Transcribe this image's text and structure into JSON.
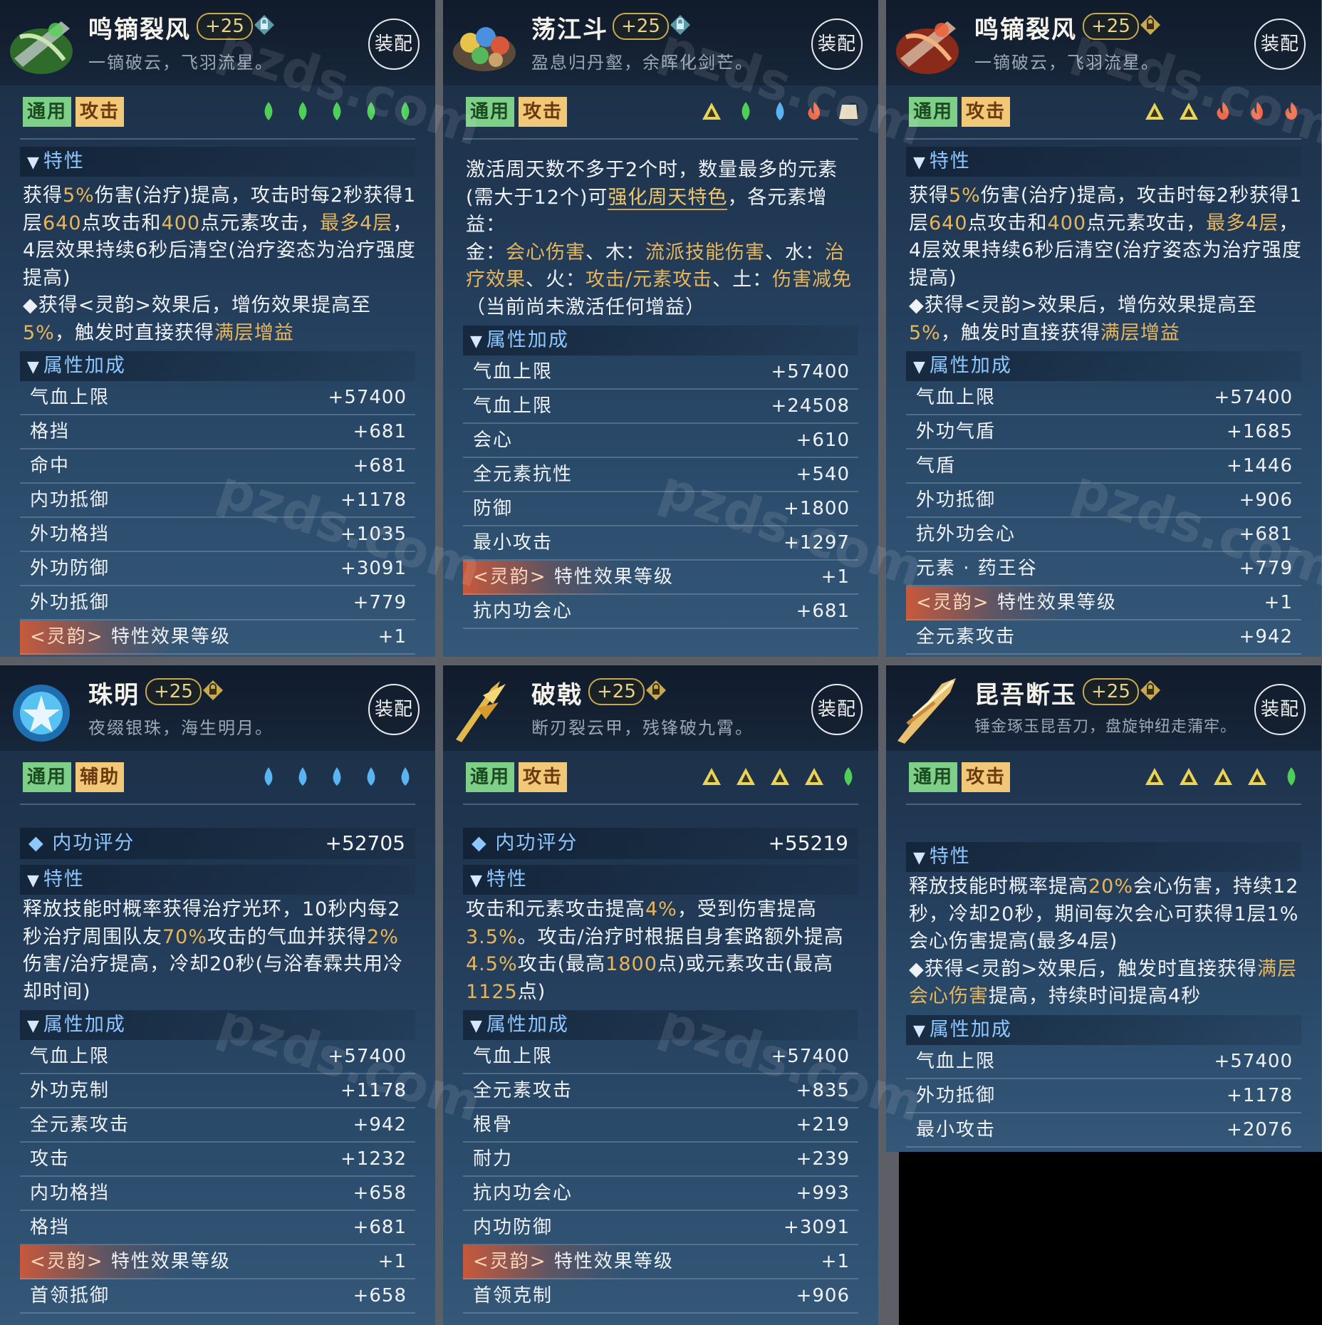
{
  "watermark": "pzds.com",
  "panels": [
    {
      "name": "鸣镝裂风",
      "level": "+25",
      "subtitle": "一镝破云，飞羽流星。",
      "equip": "装配",
      "tags": [
        "通用",
        "攻击"
      ],
      "elements": [
        "wood-icon",
        "wood-icon",
        "wood-icon",
        "wood-icon",
        "wood-icon"
      ],
      "trait_head": "特性",
      "desc": [
        "获得",
        "5%",
        "伤害(治疗)提高，攻击时每2秒获得1层",
        "640",
        "点攻击和",
        "400",
        "点元素攻击，",
        "最多4层",
        "，4层效果持续6秒后清空(治疗姿态为治疗强度提高)",
        "◆获得<灵韵>效果后，增伤效果提高至",
        "5%",
        "，触发时直接获得",
        "满层增益"
      ],
      "attr_head": "属性加成",
      "stats": [
        {
          "name": "气血上限",
          "value": "+57400"
        },
        {
          "name": "格挡",
          "value": "+681"
        },
        {
          "name": "命中",
          "value": "+681"
        },
        {
          "name": "内功抵御",
          "value": "+1178"
        },
        {
          "name": "外功格挡",
          "value": "+1035"
        },
        {
          "name": "外功防御",
          "value": "+3091"
        },
        {
          "name": "外功抵御",
          "value": "+779"
        },
        {
          "name": "<灵韵>",
          "value": "+1",
          "extra": "特性效果等级"
        }
      ]
    },
    {
      "name": "荡江斗",
      "level": "+25",
      "subtitle": "盈息归丹壑，余晖化剑芒。",
      "equip": "装配",
      "tags": [
        "通用",
        "攻击"
      ],
      "elements": [
        "metal-icon",
        "wood-icon",
        "water-icon",
        "fire-icon",
        "earth-icon"
      ],
      "desc": [
        "激活周天数不多于2个时，数量最多的元素(需大于12个)可",
        "强化周天特色",
        "，各元素增益：",
        "金：",
        "会心伤害",
        "、木：",
        "流派技能伤害",
        "、水：",
        "治疗效果",
        "、火：",
        "攻击/元素攻击",
        "、土：",
        "伤害减免",
        "（当前尚未激活任何增益）"
      ],
      "attr_head": "属性加成",
      "stats": [
        {
          "name": "气血上限",
          "value": "+57400"
        },
        {
          "name": "气血上限",
          "value": "+24508"
        },
        {
          "name": "会心",
          "value": "+610"
        },
        {
          "name": "全元素抗性",
          "value": "+540"
        },
        {
          "name": "防御",
          "value": "+1800"
        },
        {
          "name": "最小攻击",
          "value": "+1297"
        },
        {
          "name": "<灵韵>",
          "value": "+1",
          "extra": "特性效果等级"
        },
        {
          "name": "抗内功会心",
          "value": "+681"
        }
      ]
    },
    {
      "name": "鸣镝裂风",
      "level": "+25",
      "subtitle": "一镝破云，飞羽流星。",
      "equip": "装配",
      "tags": [
        "通用",
        "攻击"
      ],
      "elements": [
        "metal-icon",
        "metal-icon",
        "fire-icon",
        "fire-icon",
        "fire-icon"
      ],
      "trait_head": "特性",
      "desc": [
        "获得",
        "5%",
        "伤害(治疗)提高，攻击时每2秒获得1层",
        "640",
        "点攻击和",
        "400",
        "点元素攻击，",
        "最多4层",
        "，4层效果持续6秒后清空(治疗姿态为治疗强度提高)",
        "◆获得<灵韵>效果后，增伤效果提高至",
        "5%",
        "，触发时直接获得",
        "满层增益"
      ],
      "attr_head": "属性加成",
      "stats": [
        {
          "name": "气血上限",
          "value": "+57400"
        },
        {
          "name": "外功气盾",
          "value": "+1685"
        },
        {
          "name": "气盾",
          "value": "+1446"
        },
        {
          "name": "外功抵御",
          "value": "+906"
        },
        {
          "name": "抗外功会心",
          "value": "+681"
        },
        {
          "name": "元素 · 药王谷",
          "value": "+779"
        },
        {
          "name": "<灵韵>",
          "value": "+1",
          "extra": "特性效果等级"
        },
        {
          "name": "全元素攻击",
          "value": "+942"
        }
      ]
    },
    {
      "name": "珠明",
      "level": "+25",
      "subtitle": "夜缀银珠，海生明月。",
      "equip": "装配",
      "tags": [
        "通用",
        "辅助"
      ],
      "elements": [
        "water-icon",
        "water-icon",
        "water-icon",
        "water-icon",
        "water-icon"
      ],
      "score_label": "内功评分",
      "score": "+52705",
      "trait_head": "特性",
      "desc": [
        "释放技能时概率获得治疗光环，10秒内每2秒治疗周围队友",
        "70%",
        "攻击的气血并获得",
        "2%",
        "伤害/治疗提高，冷却20秒(与浴春霖共用冷却时间)"
      ],
      "attr_head": "属性加成",
      "stats": [
        {
          "name": "气血上限",
          "value": "+57400"
        },
        {
          "name": "外功克制",
          "value": "+1178"
        },
        {
          "name": "全元素攻击",
          "value": "+942"
        },
        {
          "name": "攻击",
          "value": "+1232"
        },
        {
          "name": "内功格挡",
          "value": "+658"
        },
        {
          "name": "格挡",
          "value": "+681"
        },
        {
          "name": "<灵韵>",
          "value": "+1",
          "extra": "特性效果等级"
        },
        {
          "name": "首领抵御",
          "value": "+658"
        }
      ]
    },
    {
      "name": "破戟",
      "level": "+25",
      "subtitle": "断刃裂云甲，残锋破九霄。",
      "equip": "装配",
      "tags": [
        "通用",
        "攻击"
      ],
      "elements": [
        "metal-icon",
        "metal-icon",
        "metal-icon",
        "metal-icon",
        "wood-icon"
      ],
      "score_label": "内功评分",
      "score": "+55219",
      "trait_head": "特性",
      "desc": [
        "攻击和元素攻击提高",
        "4%",
        "，受到伤害提高",
        "3.5%",
        "。攻击/治疗时根据自身套路额外提高",
        "4.5%",
        "攻击(最高",
        "1800",
        "点)或元素攻击(最高",
        "1125",
        "点)"
      ],
      "attr_head": "属性加成",
      "stats": [
        {
          "name": "气血上限",
          "value": "+57400"
        },
        {
          "name": "全元素攻击",
          "value": "+835"
        },
        {
          "name": "根骨",
          "value": "+219"
        },
        {
          "name": "耐力",
          "value": "+239"
        },
        {
          "name": "抗内功会心",
          "value": "+993"
        },
        {
          "name": "内功防御",
          "value": "+3091"
        },
        {
          "name": "<灵韵>",
          "value": "+1",
          "extra": "特性效果等级"
        },
        {
          "name": "首领克制",
          "value": "+906"
        }
      ]
    },
    {
      "name": "昆吾断玉",
      "level": "+25",
      "subtitle": "锤金琢玉昆吾刀，盘旋钟纽走蒲牢。",
      "equip": "装配",
      "tags": [
        "通用",
        "攻击"
      ],
      "elements": [
        "metal-icon",
        "metal-icon",
        "metal-icon",
        "metal-icon",
        "wood-icon"
      ],
      "trait_head": "特性",
      "desc": [
        "释放技能时概率提高",
        "20%",
        "会心伤害，持续12秒，冷却20秒，期间每次会心可获得1层1%会心伤害提高(最多4层)",
        "◆获得<灵韵>效果后，触发时直接获得",
        "满层会心伤害",
        "提高，持续时间提高4秒"
      ],
      "attr_head": "属性加成",
      "stats": [
        {
          "name": "气血上限",
          "value": "+57400"
        },
        {
          "name": "外功抵御",
          "value": "+1178"
        },
        {
          "name": "最小攻击",
          "value": "+2076"
        }
      ]
    }
  ]
}
